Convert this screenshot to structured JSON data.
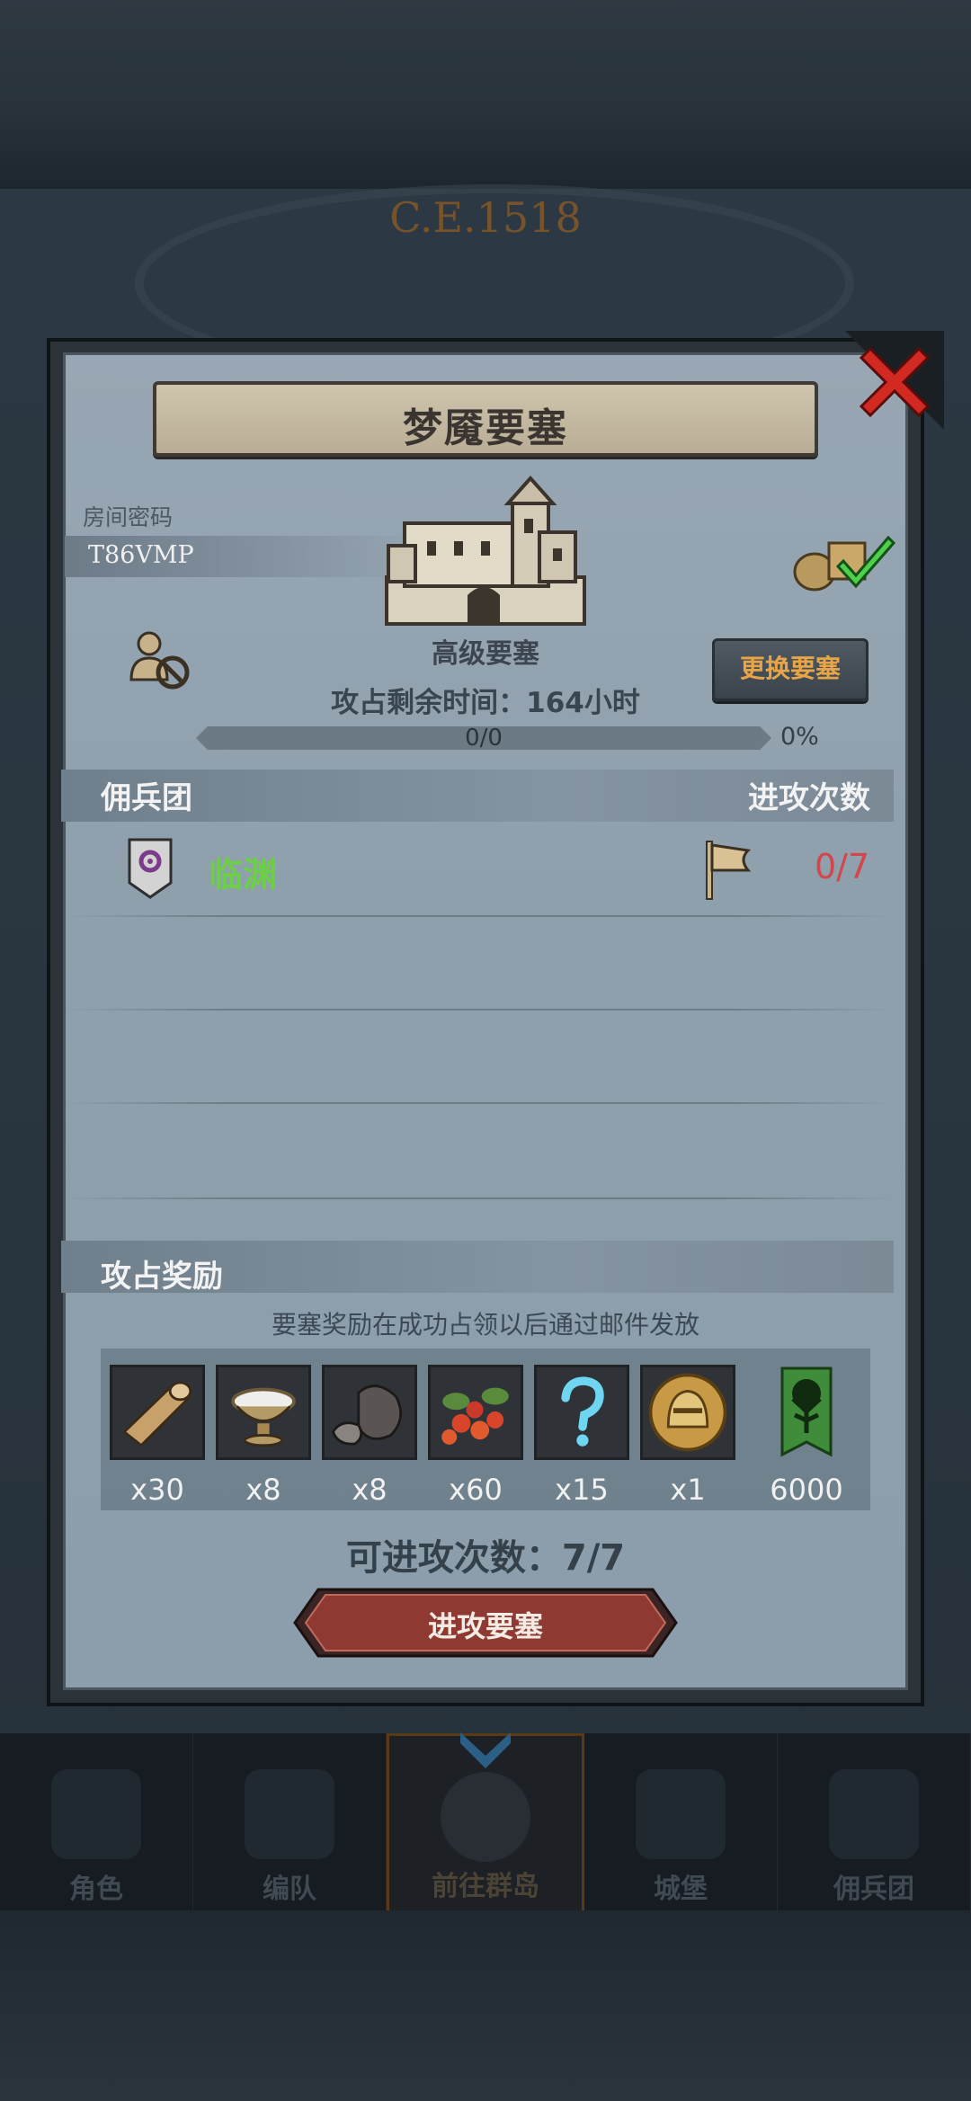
{
  "header": {
    "era": "C.E.1518"
  },
  "dialog": {
    "title": "梦魇要塞",
    "room_label": "房间密码",
    "room_code": "T86VMP",
    "fortress_type": "高级要塞",
    "remaining_time": "攻占剩余时间：164小时",
    "swap_button": "更换要塞",
    "progress": {
      "text": "0/0",
      "percent_text": "0%",
      "value": 0
    },
    "mercenary_header": "佣兵团",
    "attack_count_header": "进攻次数",
    "mercenaries": [
      {
        "name": "临渊",
        "attacks": "0/7"
      }
    ],
    "reward_header": "攻占奖励",
    "reward_note": "要塞奖励在成功占领以后通过邮件发放",
    "rewards": [
      {
        "icon": "wood-log-icon",
        "qty": "x30"
      },
      {
        "icon": "silver-bowl-icon",
        "qty": "x8"
      },
      {
        "icon": "ore-stone-icon",
        "qty": "x8"
      },
      {
        "icon": "berries-icon",
        "qty": "x60"
      },
      {
        "icon": "mystery-question-icon",
        "qty": "x15"
      },
      {
        "icon": "knight-helmet-coin-icon",
        "qty": "x1"
      },
      {
        "icon": "guild-tree-banner-icon",
        "qty": "6000"
      }
    ],
    "attacks_available": "可进攻次数：7/7",
    "attack_button": "进攻要塞"
  },
  "nav": {
    "items": [
      {
        "label": "角色",
        "active": false
      },
      {
        "label": "编队",
        "active": false
      },
      {
        "label": "前往群岛",
        "active": true
      },
      {
        "label": "城堡",
        "active": false
      },
      {
        "label": "佣兵团",
        "active": false
      }
    ]
  },
  "colors": {
    "green_name": "#6dce48",
    "red_count": "#d3464c",
    "accent_orange": "#e7a548"
  }
}
